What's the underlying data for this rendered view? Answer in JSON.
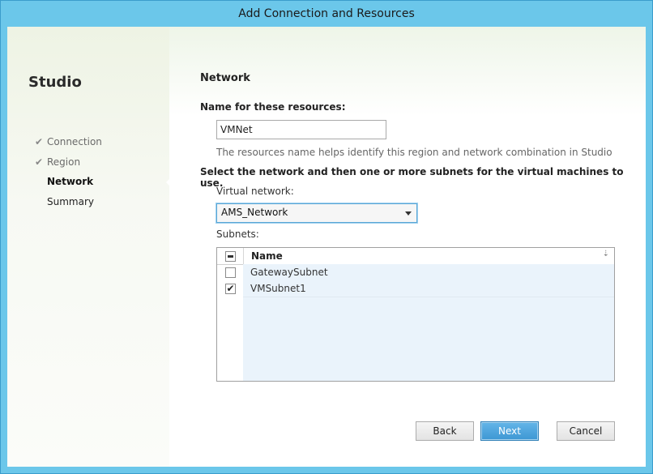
{
  "window": {
    "title": "Add Connection and Resources"
  },
  "sidebar": {
    "title": "Studio",
    "steps": [
      {
        "label": "Connection",
        "state": "done"
      },
      {
        "label": "Region",
        "state": "done"
      },
      {
        "label": "Network",
        "state": "active"
      },
      {
        "label": "Summary",
        "state": "pending"
      }
    ]
  },
  "main": {
    "heading": "Network",
    "name_label": "Name for these resources:",
    "name_value": "VMNet",
    "name_hint": "The resources name helps identify this region and network combination in Studio",
    "select_instruction": "Select the network and then one or more subnets for the virtual machines to use.",
    "vnet_label": "Virtual network:",
    "vnet_value": "AMS_Network",
    "subnets_label": "Subnets:",
    "subnets_table": {
      "column": "Name",
      "rows": [
        {
          "name": "GatewaySubnet",
          "checked": false
        },
        {
          "name": "VMSubnet1",
          "checked": true
        }
      ]
    }
  },
  "buttons": {
    "back": "Back",
    "next": "Next",
    "cancel": "Cancel"
  },
  "colors": {
    "titlebar": "#6bc7ea",
    "accent": "#3d97d3"
  }
}
